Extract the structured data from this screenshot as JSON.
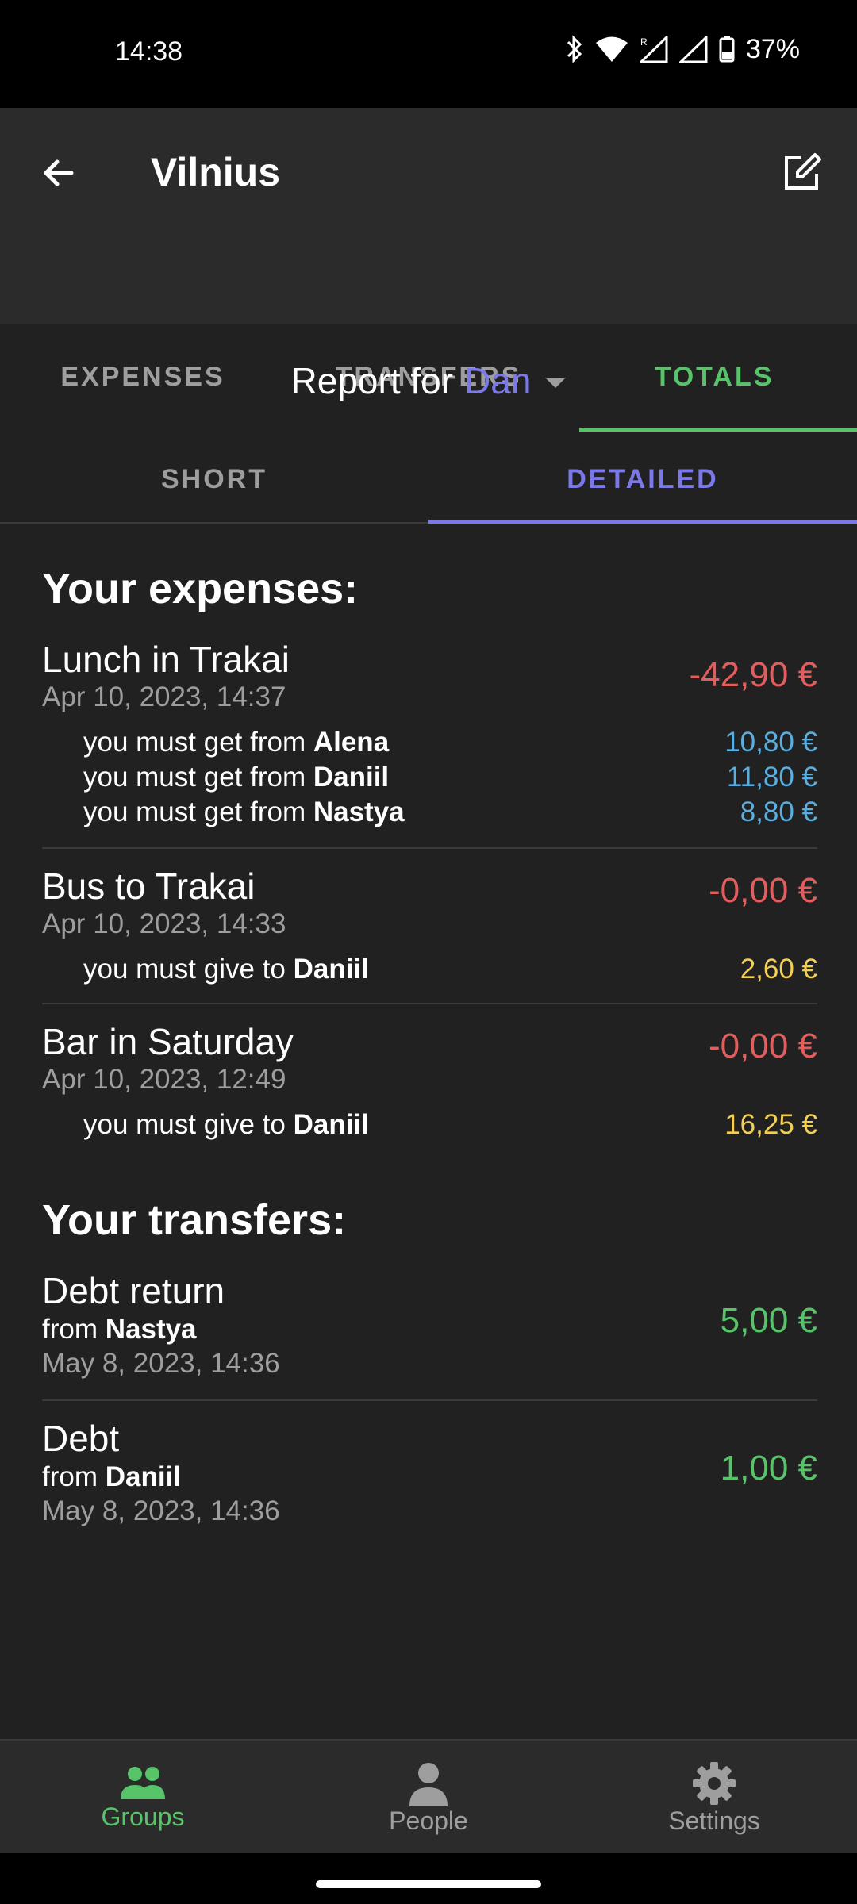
{
  "status": {
    "time": "14:38",
    "battery": "37%"
  },
  "appbar": {
    "title": "Vilnius"
  },
  "tabs": [
    {
      "label": "EXPENSES"
    },
    {
      "label": "TRANSFERS"
    },
    {
      "label": "TOTALS"
    }
  ],
  "report": {
    "prefix": "Report for",
    "person": "Dan"
  },
  "subtabs": [
    {
      "label": "SHORT"
    },
    {
      "label": "DETAILED"
    }
  ],
  "expenses": {
    "heading": "Your expenses:",
    "items": [
      {
        "title": "Lunch in Trakai",
        "date": "Apr 10, 2023, 14:37",
        "amount": "-42,90 €",
        "lines": [
          {
            "text": "you must get from",
            "name": "Alena",
            "amount": "10,80 €"
          },
          {
            "text": "you must get from",
            "name": "Daniil",
            "amount": "11,80 €"
          },
          {
            "text": "you must get from",
            "name": "Nastya",
            "amount": "8,80 €"
          }
        ]
      },
      {
        "title": "Bus to Trakai",
        "date": "Apr 10, 2023, 14:33",
        "amount": "-0,00 €",
        "lines": [
          {
            "text": "you must give to",
            "name": "Daniil",
            "amount": "2,60 €"
          }
        ]
      },
      {
        "title": "Bar in Saturday",
        "date": "Apr 10, 2023, 12:49",
        "amount": "-0,00 €",
        "lines": [
          {
            "text": "you must give to",
            "name": "Daniil",
            "amount": "16,25 €"
          }
        ]
      }
    ]
  },
  "transfers": {
    "heading": "Your transfers:",
    "items": [
      {
        "title": "Debt return",
        "from_label": "from",
        "from_name": "Nastya",
        "date": "May 8, 2023, 14:36",
        "amount": "5,00 €"
      },
      {
        "title": "Debt",
        "from_label": "from",
        "from_name": "Daniil",
        "date": "May 8, 2023, 14:36",
        "amount": "1,00 €"
      }
    ]
  },
  "bottomnav": [
    {
      "label": "Groups",
      "icon": "groups-icon"
    },
    {
      "label": "People",
      "icon": "person-icon"
    },
    {
      "label": "Settings",
      "icon": "gear-icon"
    }
  ],
  "colors": {
    "accent_green": "#57c46a",
    "accent_purple": "#7b78e8",
    "negative": "#e35d5d",
    "receive": "#5aaee0",
    "give": "#f2cf55"
  }
}
